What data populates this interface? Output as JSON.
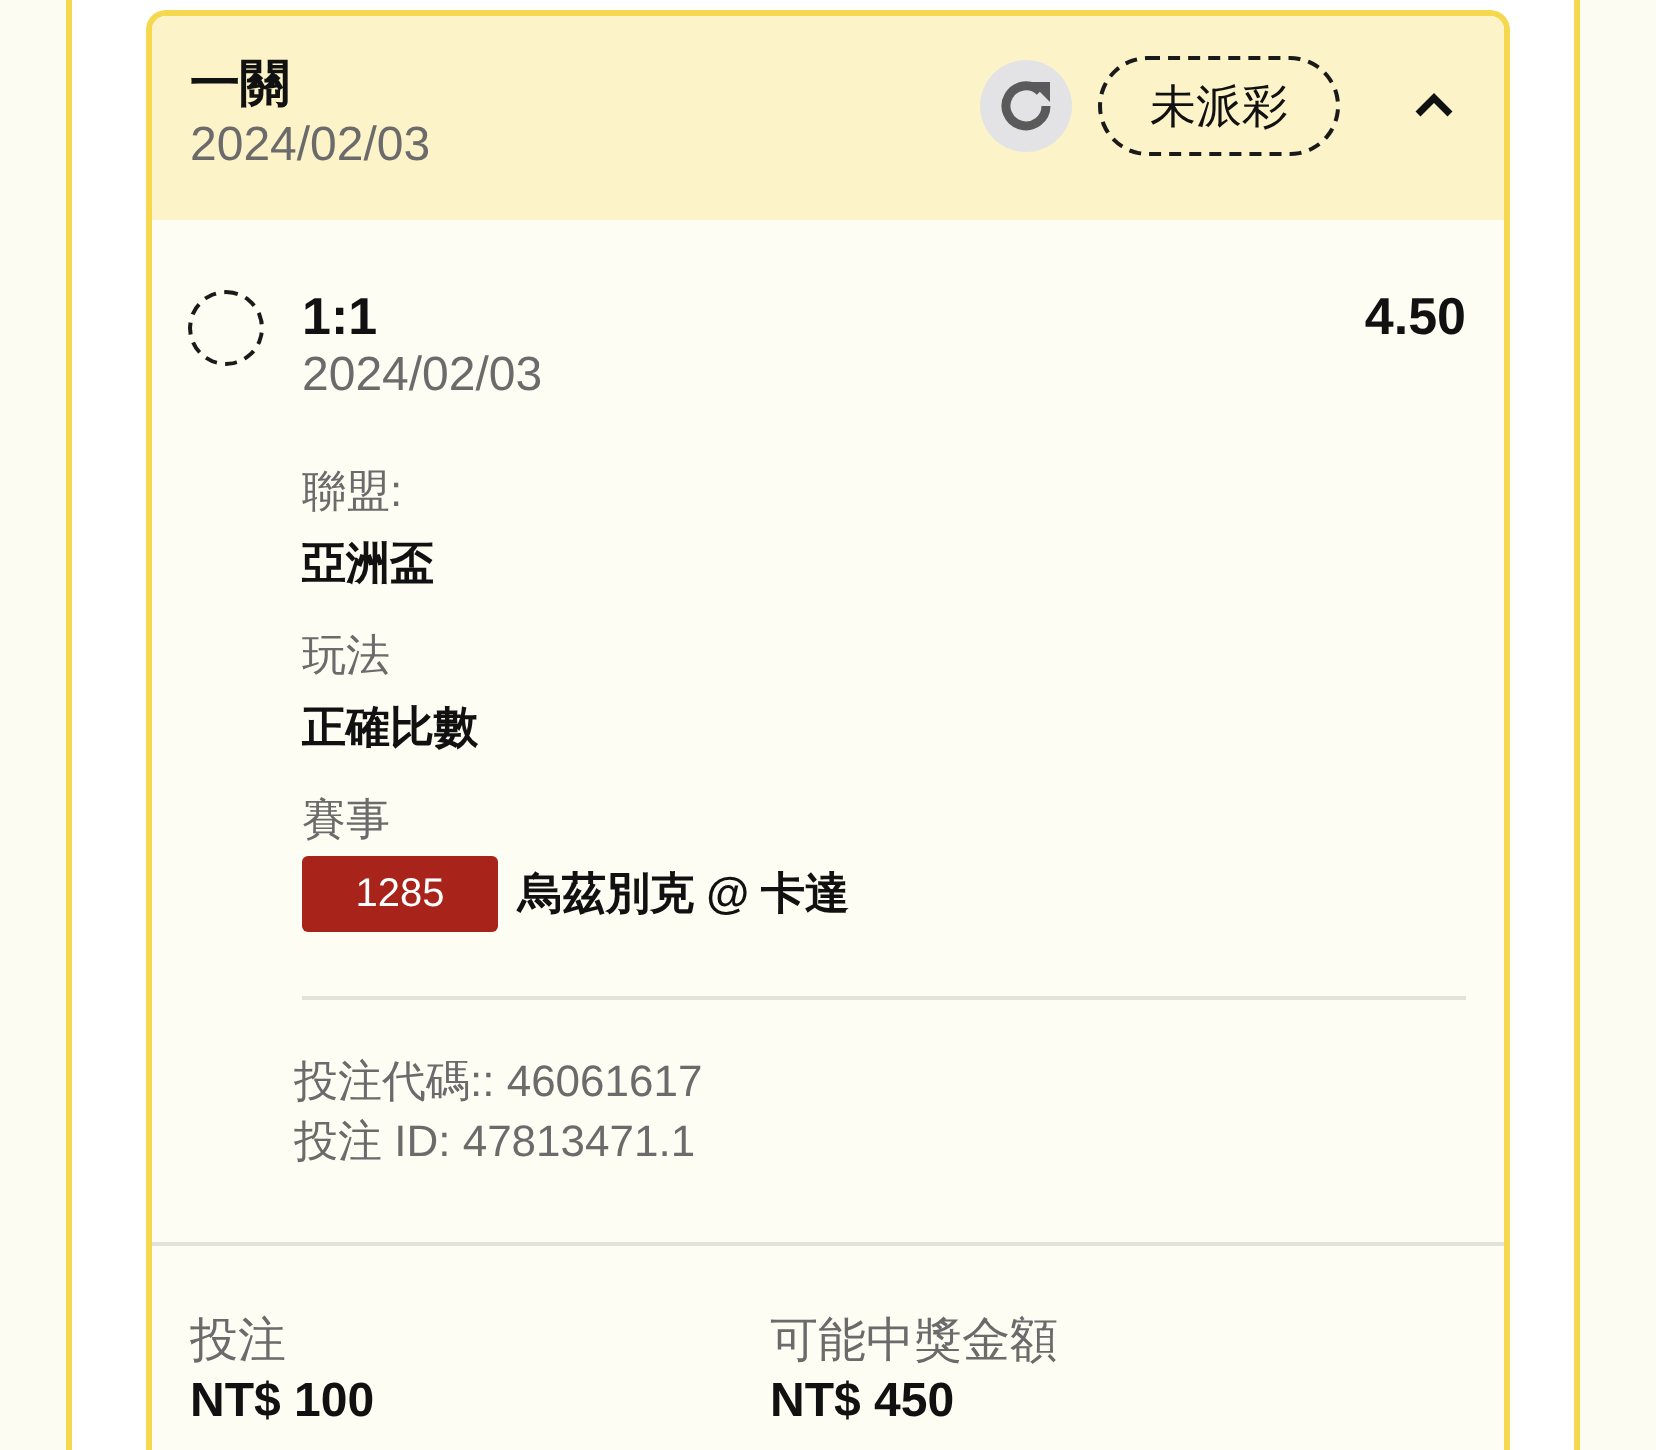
{
  "bet": {
    "title": "一關",
    "date": "2024/02/03",
    "status": "未派彩",
    "expanded": true
  },
  "selection": {
    "score": "1:1",
    "date": "2024/02/03",
    "odds": "4.50",
    "selected": false
  },
  "details": [
    {
      "label": "聯盟:",
      "value": "亞洲盃"
    },
    {
      "label": "玩法",
      "value": "正確比數"
    },
    {
      "label": "賽事",
      "badge": "1285",
      "value": "烏茲別克 @ 卡達"
    }
  ],
  "codes": [
    "投注代碼:: 46061617",
    "投注 ID: 47813471.1"
  ],
  "summary": [
    {
      "label": "投注",
      "value": "NT$ 100"
    },
    {
      "label": "可能中獎金額",
      "value": "NT$ 450"
    }
  ]
}
